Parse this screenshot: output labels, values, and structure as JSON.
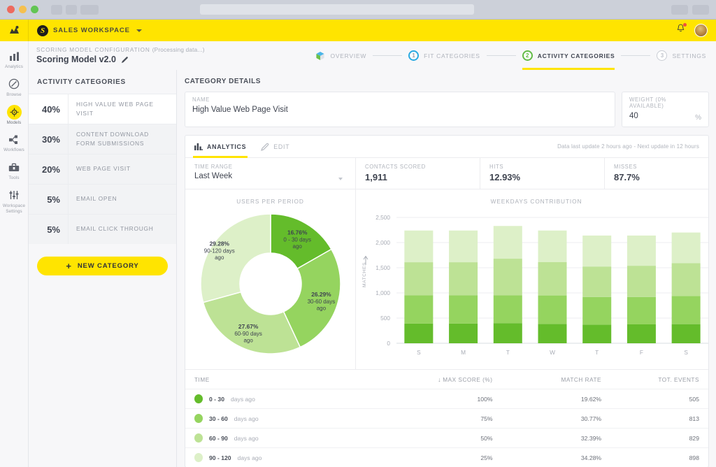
{
  "browser": {
    "window_controls": [
      "close",
      "minimize",
      "maximize"
    ]
  },
  "topbar": {
    "logo": "logo-icon",
    "workspace_badge": "S",
    "workspace_name": "SALES WORKSPACE",
    "bell": "bell-icon",
    "avatar": "user-avatar"
  },
  "rail": {
    "items": [
      {
        "label": "Analytics",
        "icon": "bar-chart-icon",
        "active": false
      },
      {
        "label": "Browse",
        "icon": "compass-icon",
        "active": false
      },
      {
        "label": "Models",
        "icon": "model-target-icon",
        "active": true
      },
      {
        "label": "Workflows",
        "icon": "nodes-icon",
        "active": false
      },
      {
        "label": "Tools",
        "icon": "toolbox-icon",
        "active": false
      },
      {
        "label": "Workspace Settings",
        "icon": "sliders-icon",
        "active": false
      }
    ]
  },
  "breadcrumb": {
    "section": "SCORING MODEL CONFIGURATION",
    "status": "(Processing data...)",
    "title": "Scoring Model v2.0",
    "edit_icon": "pencil-icon"
  },
  "stepper": {
    "steps": [
      {
        "num": "",
        "label": "OVERVIEW",
        "state": "overview"
      },
      {
        "num": "1",
        "label": "FIT CATEGORIES",
        "state": "done"
      },
      {
        "num": "2",
        "label": "ACTIVITY CATEGORIES",
        "state": "current"
      },
      {
        "num": "3",
        "label": "SETTINGS",
        "state": "pending"
      }
    ]
  },
  "categories_panel": {
    "title": "ACTIVITY CATEGORIES",
    "rows": [
      {
        "pct": "40%",
        "name": "HIGH VALUE WEB PAGE VISIT",
        "active": true
      },
      {
        "pct": "30%",
        "name": "CONTENT DOWNLOAD FORM SUBMISSIONS",
        "active": false
      },
      {
        "pct": "20%",
        "name": "WEB PAGE VISIT",
        "active": false
      },
      {
        "pct": "5%",
        "name": "EMAIL OPEN",
        "active": false
      },
      {
        "pct": "5%",
        "name": "EMAIL CLICK THROUGH",
        "active": false
      }
    ],
    "new_category_label": "NEW CATEGORY"
  },
  "details": {
    "title": "CATEGORY DETAILS",
    "name_label": "NAME",
    "name_value": "High Value Web Page Visit",
    "weight_label": "WEIGHT (0% AVAILABLE)",
    "weight_value": "40",
    "percent_sign": "%"
  },
  "tabs": {
    "analytics": "ANALYTICS",
    "edit": "EDIT",
    "update_note": "Data last update 2 hours ago - Next update in 12 hours"
  },
  "stats": {
    "time_range_label": "TIME RANGE",
    "time_range_value": "Last Week",
    "contacts_label": "CONTACTS SCORED",
    "contacts_value": "1,911",
    "hits_label": "HITS",
    "hits_value": "12.93%",
    "misses_label": "MISSES",
    "misses_value": "87.7%"
  },
  "table": {
    "headers": {
      "time": "TIME",
      "score": "MAX SCORE (%)",
      "rate": "MATCH RATE",
      "events": "TOT. EVENTS"
    },
    "sort_icon": "sort-down-arrow",
    "rows": [
      {
        "range": "0 - 30",
        "ago": "days ago",
        "score": "100%",
        "rate": "19.62%",
        "events": "505",
        "color": "#64bc2b"
      },
      {
        "range": "30 - 60",
        "ago": "days ago",
        "score": "75%",
        "rate": "30.77%",
        "events": "813",
        "color": "#95d45f"
      },
      {
        "range": "60 - 90",
        "ago": "days ago",
        "score": "50%",
        "rate": "32.39%",
        "events": "829",
        "color": "#bde295"
      },
      {
        "range": "90 - 120",
        "ago": "days ago",
        "score": "25%",
        "rate": "34.28%",
        "events": "898",
        "color": "#ddf0c8"
      }
    ]
  },
  "chart_data": [
    {
      "type": "pie",
      "title": "USERS PER PERIOD",
      "donut": true,
      "labels": [
        "0 - 30 days ago",
        "30-60 days ago",
        "60-90 days ago",
        "90-120 days ago"
      ],
      "values": [
        16.76,
        26.29,
        27.67,
        29.28
      ],
      "value_labels": [
        "16.76%",
        "26.29%",
        "27.67%",
        "29.28%"
      ],
      "colors": [
        "#64bc2b",
        "#95d45f",
        "#bde295",
        "#ddf0c8"
      ],
      "legend": "labels-on-slices"
    },
    {
      "type": "bar",
      "title": "WEEKDAYS CONTRIBUTION",
      "stacked": true,
      "categories": [
        "S",
        "M",
        "T",
        "W",
        "T",
        "F",
        "S"
      ],
      "xlabel": "",
      "ylabel": "MATCHES",
      "ylim": [
        0,
        2500
      ],
      "yticks": [
        0,
        500,
        1000,
        1500,
        2000,
        2500
      ],
      "ytick_labels": [
        "0",
        "500",
        "1,000",
        "1,500",
        "2,000",
        "2,500"
      ],
      "grid": true,
      "series": [
        {
          "name": "0 - 30 days ago",
          "color": "#64bc2b",
          "values": [
            390,
            390,
            400,
            385,
            370,
            375,
            380
          ]
        },
        {
          "name": "30-60 days ago",
          "color": "#95d45f",
          "values": [
            565,
            565,
            555,
            565,
            550,
            545,
            560
          ]
        },
        {
          "name": "60-90 days ago",
          "color": "#bde295",
          "values": [
            655,
            655,
            725,
            665,
            605,
            620,
            650
          ]
        },
        {
          "name": "90-120 days ago",
          "color": "#ddf0c8",
          "values": [
            630,
            630,
            650,
            625,
            615,
            600,
            610
          ]
        }
      ],
      "totals": [
        2240,
        2240,
        2330,
        2240,
        2140,
        2140,
        2200
      ]
    }
  ]
}
